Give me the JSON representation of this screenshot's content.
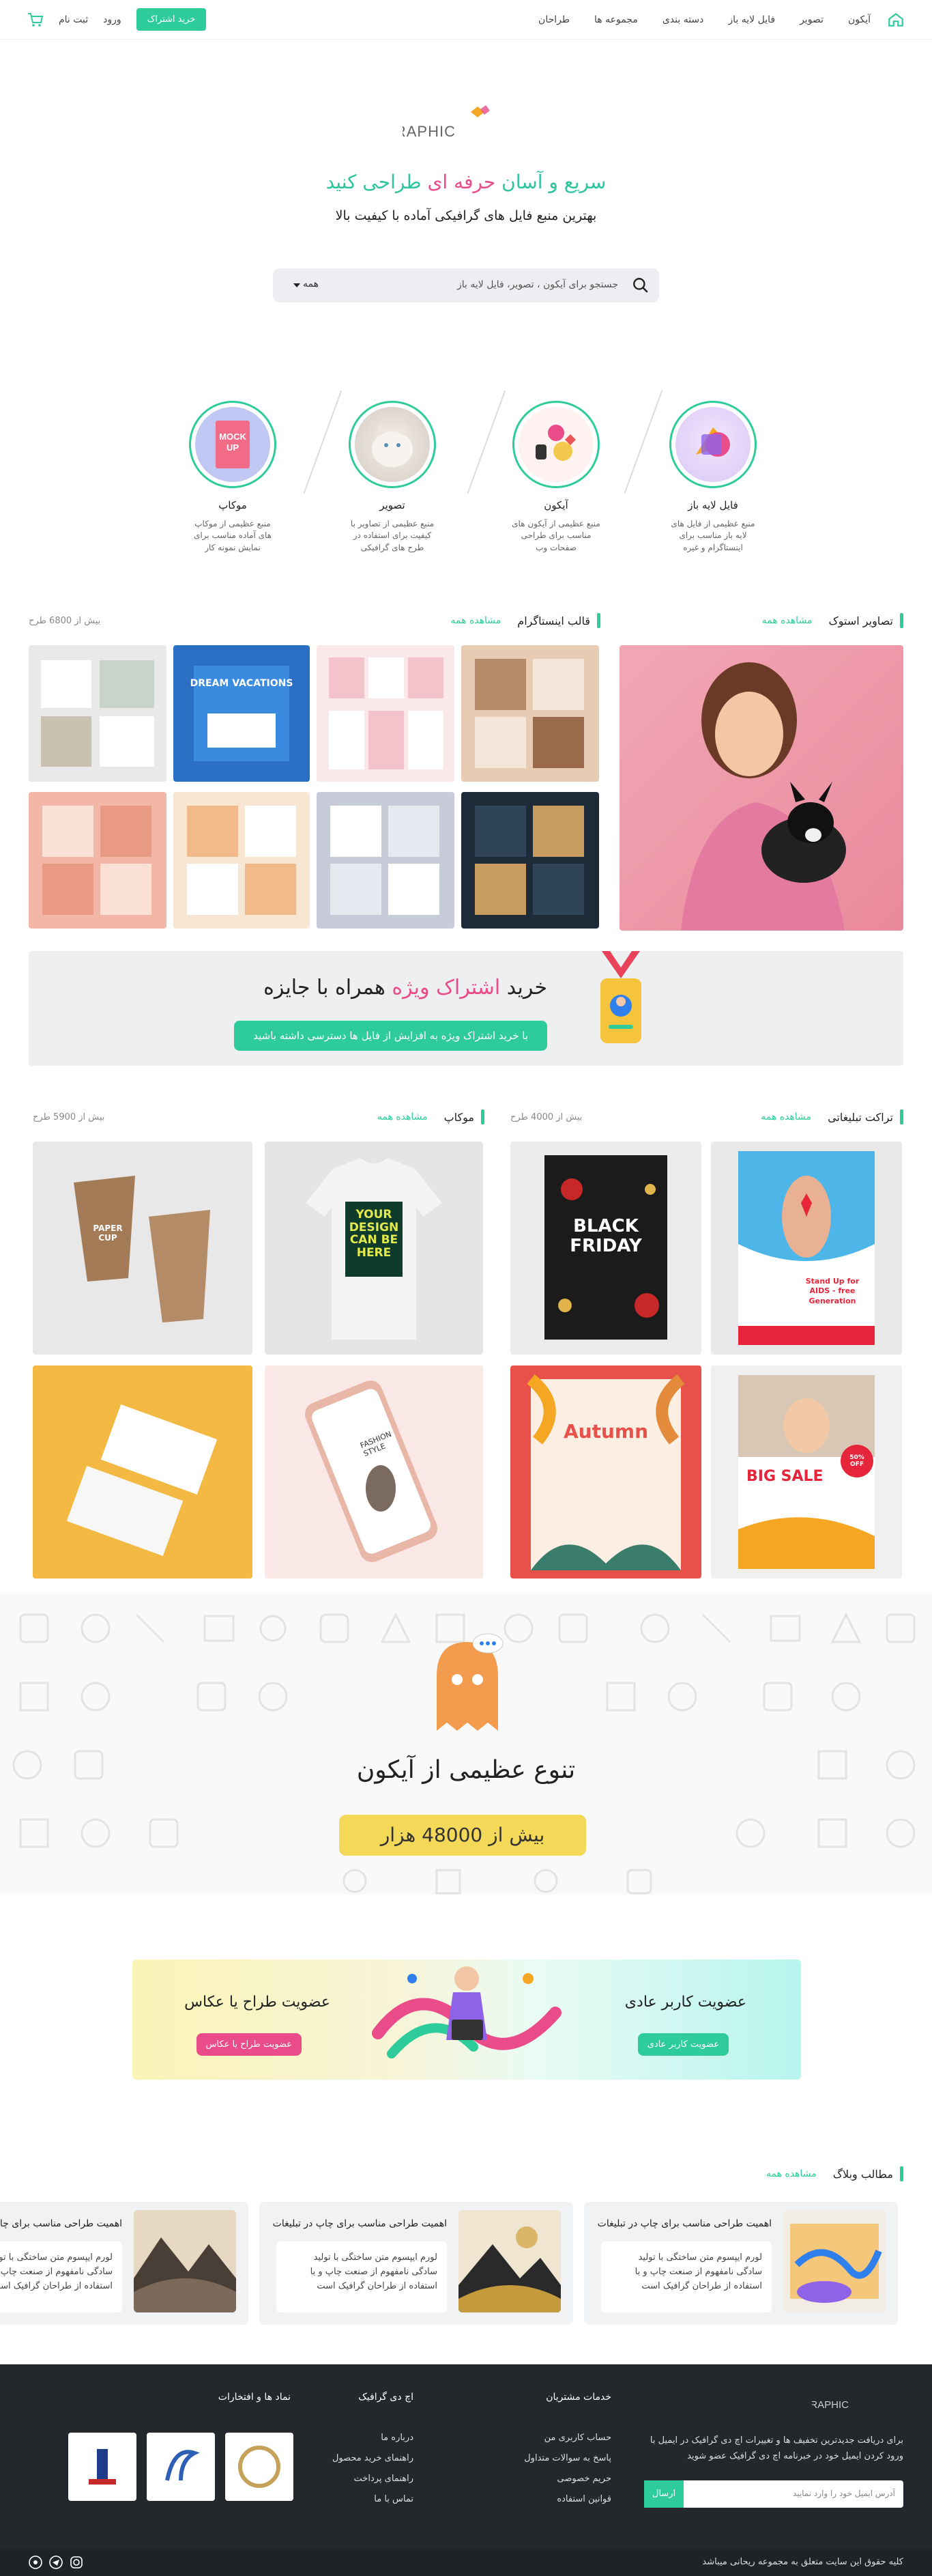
{
  "header": {
    "nav": [
      "آیکون",
      "تصویر",
      "فایل لایه باز",
      "دسته بندی",
      "مجموعه ها",
      "طراحان"
    ],
    "subscribe": "خرید اشتراک",
    "login": "ورود",
    "register": "ثبت نام"
  },
  "hero": {
    "logo_text": "HD GRAPHIC",
    "tagline_a": "سریع و آسان ",
    "tagline_b": "حرفه ای",
    "tagline_c": " طراحی کنید",
    "subtitle": "بهترین منبع فایل های گرافیکی آماده با کیفیت بالا",
    "search_placeholder": "جستجو برای آیکون ، تصویر، فایل لایه باز",
    "search_scope": "همه"
  },
  "categories": [
    {
      "title": "فایل لایه باز",
      "desc": "منبع عظیمی از فایل های لایه باز مناسب برای اینستاگرام و غیره"
    },
    {
      "title": "آیکون",
      "desc": "منبع عظیمی از آیکون های مناسب برای طراحی صفحات وب"
    },
    {
      "title": "تصویر",
      "desc": "منبع عظیمی از تصاویر با کیفیت برای استفاده در طرح های گرافیکی"
    },
    {
      "title": "موکاپ",
      "desc": "منبع عظیمی از موکاپ های آماده مناسب برای نمایش نمونه کار"
    }
  ],
  "sections": {
    "stock": {
      "title": "تصاویر استوک",
      "all": "مشاهده همه"
    },
    "insta": {
      "title": "قالب اینستاگرام",
      "all": "مشاهده همه",
      "count": "بیش از 6800 طرح"
    },
    "flyers": {
      "title": "تراکت تبلیغاتی",
      "all": "مشاهده همه",
      "count": "بیش از 4000 طرح"
    },
    "mockups": {
      "title": "موکاپ",
      "all": "مشاهده همه",
      "count": "بیش از 5900 طرح"
    }
  },
  "insta_tiles": [
    "DREAM VACATIONS"
  ],
  "banner": {
    "h_a": "خرید ",
    "h_b": "اشتراک ویژه",
    "h_c": " همراه با جایزه",
    "button": "با خرید اشتراک ویژه به افزایش از فایل ها دسترسی داشته باشید"
  },
  "flyer_texts": {
    "aids": "Stand Up for AIDS - free Generation",
    "black_friday_a": "BLACK",
    "black_friday_b": "FRIDAY",
    "autumn": "Autumn",
    "sale": "BIG SALE",
    "sale_pct": "50% OFF"
  },
  "mockup_texts": {
    "cup": "PAPER CUP",
    "shirt": "YOUR DESIGN CAN BE HERE",
    "phone": "FASHION STYLE"
  },
  "icons_section": {
    "title": "تنوع عظیمی از آیکون",
    "count": "بیش از 48000 هزار"
  },
  "membership": {
    "user_title": "عضویت کاربر عادی",
    "user_btn": "عضویت کاربر عادی",
    "designer_title": "عضویت طراح یا عکاس",
    "designer_btn": "عضویت طراح یا عکاس"
  },
  "blog": {
    "title": "مطالب وبلاگ",
    "all": "مشاهده همه",
    "cards": [
      {
        "title": "اهمیت طراحی مناسب برای چاپ در تبلیغات",
        "excerpt": "لورم ایپسوم متن ساختگی با تولید سادگی نامفهوم از صنعت چاپ و با استفاده از طراحان گرافیک است"
      },
      {
        "title": "اهمیت طراحی مناسب برای چاپ در تبلیغات",
        "excerpt": "لورم ایپسوم متن ساختگی با تولید سادگی نامفهوم از صنعت چاپ و با استفاده از طراحان گرافیک است"
      },
      {
        "title": "اهمیت طراحی مناسب برای چاپ در تبلیغات",
        "excerpt": "لورم ایپسوم متن ساختگی با تولید سادگی نامفهوم از صنعت چاپ و با استفاده از طراحان گرافیک است"
      }
    ]
  },
  "footer": {
    "about": "برای دریافت جدیدترین تخفیف ها و تغییرات اچ دی گرافیک در ایمیل با ورود کردن ایمیل خود در خبرنامه اچ دی گرافیک عضو شوید",
    "email_placeholder": "آدرس ایمیل خود را وارد نمایید",
    "send": "ارسال",
    "col1_title": "خدمات مشتریان",
    "col1": [
      "حساب کاربری من",
      "پاسخ به سوالات متداول",
      "حریم خصوصی",
      "قوانین استفاده"
    ],
    "col2_title": "اچ دی گرافیک",
    "col2": [
      "درباره ما",
      "راهنمای خرید محصول",
      "راهنمای پرداخت",
      "تماس با ما"
    ],
    "col3_title": "نماد ها و افتخارات",
    "copyright": "کلیه حقوق این سایت متعلق به مجموعه ریحانی میباشد"
  }
}
